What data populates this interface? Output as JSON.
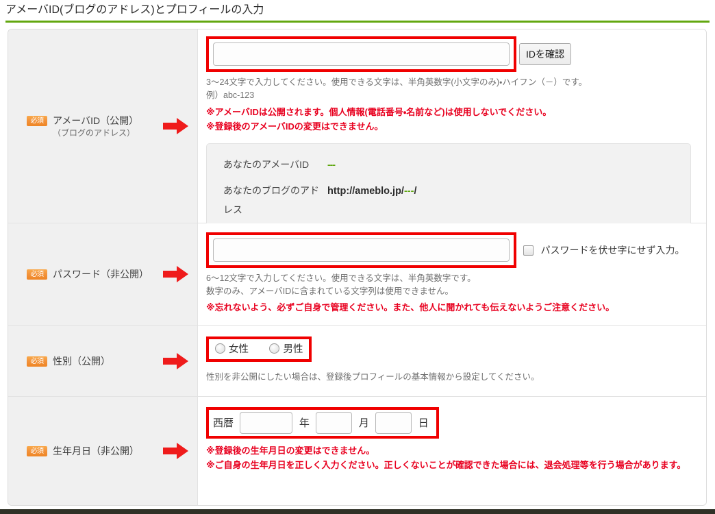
{
  "page": {
    "heading": "アメーバID(ブログのアドレス)とプロフィールの入力",
    "accent_green": "#62a70f",
    "annotation_red": "#f00000",
    "required_badge_orange": "#f2923a",
    "warning_red": "#e8001f"
  },
  "required_badge_label": "必須",
  "rows": {
    "ameba_id": {
      "label": "アメーバID（公開）",
      "sublabel": "（ブログのアドレス）",
      "input_value": "",
      "input_placeholder": "",
      "check_button_label": "IDを確認",
      "hints": [
        "3〜24文字で入力してください。使用できる文字は、半角英数字(小文字のみ)・ハイフン（－）です。",
        "例）abc-123"
      ],
      "warnings": [
        "※アメーバIDは公開されます。個人情報(電話番号・名前など)は使用しないでください。",
        "※登録後のアメーバIDの変更はできません。"
      ],
      "info_panel": {
        "id_key": "あなたのアメーバID",
        "id_value": "---",
        "url_key": "あなたのブログのアドレス",
        "url_prefix": "http://ameblo.jp/",
        "url_id": "---",
        "url_suffix": "/"
      }
    },
    "password": {
      "label": "パスワード（非公開）",
      "input_value": "",
      "input_placeholder": "",
      "show_password_label": "パスワードを伏せ字にせず入力。",
      "show_password_checked": false,
      "hints": [
        "6〜12文字で入力してください。使用できる文字は、半角英数字です。",
        "数字のみ、アメーバIDに含まれている文字列は使用できません。"
      ],
      "warnings": [
        "※忘れないよう、必ずご自身で管理ください。また、他人に聞かれても伝えないようご注意ください。"
      ]
    },
    "gender": {
      "label": "性別（公開）",
      "options": [
        {
          "label": "女性",
          "selected": false
        },
        {
          "label": "男性",
          "selected": false
        }
      ],
      "hints": [
        "性別を非公開にしたい場合は、登録後プロフィールの基本情報から設定してください。"
      ]
    },
    "birthday": {
      "label": "生年月日（非公開）",
      "era_prefix": "西暦",
      "year_value": "",
      "year_unit": "年",
      "month_value": "",
      "month_unit": "月",
      "day_value": "",
      "day_unit": "日",
      "warnings": [
        "※登録後の生年月日の変更はできません。",
        "※ご自身の生年月日を正しく入力ください。正しくないことが確認できた場合には、退会処理等を行う場合があります。"
      ]
    }
  },
  "icons": {
    "arrow": "right-arrow-icon"
  }
}
